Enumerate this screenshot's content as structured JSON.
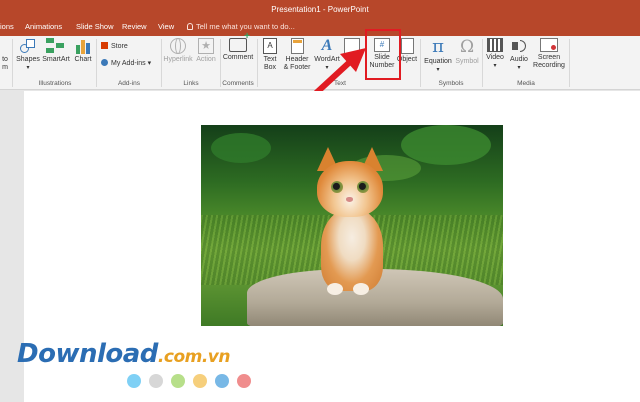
{
  "window": {
    "title": "Presentation1 - PowerPoint"
  },
  "tabs": [
    {
      "label": "ions"
    },
    {
      "label": "Animations"
    },
    {
      "label": "Slide Show"
    },
    {
      "label": "Review"
    },
    {
      "label": "View"
    }
  ],
  "tell_me": {
    "text": "Tell me what you want to do..."
  },
  "ribbon": {
    "partial_left": {
      "label_top": "to",
      "label_bottom": "m"
    },
    "illustrations": {
      "group_label": "Illustrations",
      "shapes": "Shapes",
      "smartart": "SmartArt",
      "chart": "Chart"
    },
    "addins": {
      "group_label": "Add-ins",
      "store": "Store",
      "my_addins": "My Add-ins"
    },
    "links": {
      "group_label": "Links",
      "hyperlink": "Hyperlink",
      "action": "Action"
    },
    "comments": {
      "group_label": "Comments",
      "comment": "Comment"
    },
    "text": {
      "group_label": "Text",
      "text_box_1": "Text",
      "text_box_2": "Box",
      "header_1": "Header",
      "header_2": "& Footer",
      "wordart": "WordArt",
      "date_partial": "Da",
      "slide_number_1": "Slide",
      "slide_number_2": "Number",
      "object": "Object"
    },
    "symbols": {
      "group_label": "Symbols",
      "equation": "Equation",
      "symbol": "Symbol"
    },
    "media": {
      "group_label": "Media",
      "video": "Video",
      "audio": "Audio",
      "screen_recording_1": "Screen",
      "screen_recording_2": "Recording"
    }
  },
  "watermark": {
    "brand": "Download",
    "domain": ".com.vn"
  },
  "colors": {
    "accent": "#b7472a",
    "highlight": "#e11b22",
    "dots": [
      "#7fd0f5",
      "#d7d7d7",
      "#b7df8a",
      "#f6cf7c",
      "#78b8e6",
      "#f08d8d"
    ]
  }
}
